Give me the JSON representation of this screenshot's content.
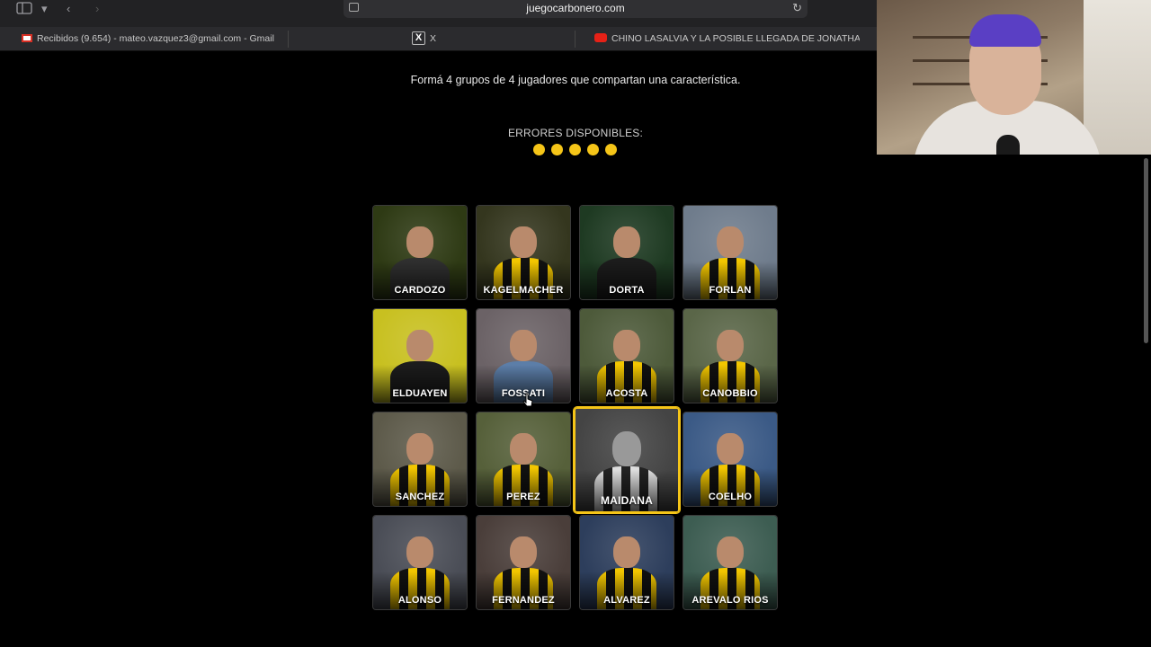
{
  "browser": {
    "url": "juegocarbonero.com",
    "tabs": [
      {
        "label": "Recibidos (9.654) - mateo.vazquez3@gmail.com - Gmail",
        "icon": "gmail-icon"
      },
      {
        "label": "X",
        "icon": "x-icon"
      },
      {
        "label": "CHINO LASALVIA Y LA POSIBLE LLEGADA DE JONATHAN R...",
        "icon": "youtube-icon"
      }
    ]
  },
  "game": {
    "instructions": "Formá 4 grupos de 4 jugadores que compartan una característica.",
    "errors_label": "ERRORES DISPONIBLES:",
    "errors_remaining": 5,
    "accent_color": "#f5c518",
    "players": [
      {
        "name": "CARDOZO",
        "selected": false,
        "style": "grey",
        "bg": "#2e3a14"
      },
      {
        "name": "KAGELMACHER",
        "selected": false,
        "style": "stripes",
        "bg": "#34361e"
      },
      {
        "name": "DORTA",
        "selected": false,
        "style": "dark",
        "bg": "#1e3a22"
      },
      {
        "name": "FORLAN",
        "selected": false,
        "style": "stripes",
        "bg": "#6f7c8c"
      },
      {
        "name": "ELDUAYEN",
        "selected": false,
        "style": "dark",
        "bg": "#c8c020"
      },
      {
        "name": "FOSSATI",
        "selected": false,
        "style": "blue",
        "bg": "#6b6266"
      },
      {
        "name": "ACOSTA",
        "selected": false,
        "style": "stripes",
        "bg": "#4d5a3a"
      },
      {
        "name": "CANOBBIO",
        "selected": false,
        "style": "stripes",
        "bg": "#5a6648"
      },
      {
        "name": "SANCHEZ",
        "selected": false,
        "style": "stripes",
        "bg": "#5d5a4a"
      },
      {
        "name": "PEREZ",
        "selected": false,
        "style": "stripes",
        "bg": "#56603a"
      },
      {
        "name": "MAIDANA",
        "selected": true,
        "style": "bw",
        "bg": "#444444"
      },
      {
        "name": "COELHO",
        "selected": false,
        "style": "stripes",
        "bg": "#3b5a86"
      },
      {
        "name": "ALONSO",
        "selected": false,
        "style": "stripes",
        "bg": "#4a4d56"
      },
      {
        "name": "FERNANDEZ",
        "selected": false,
        "style": "stripes",
        "bg": "#4a3e3a"
      },
      {
        "name": "ALVAREZ",
        "selected": false,
        "style": "stripes",
        "bg": "#2d3e5c"
      },
      {
        "name": "AREVALO RIOS",
        "selected": false,
        "style": "stripes",
        "bg": "#3d5d52"
      }
    ]
  }
}
